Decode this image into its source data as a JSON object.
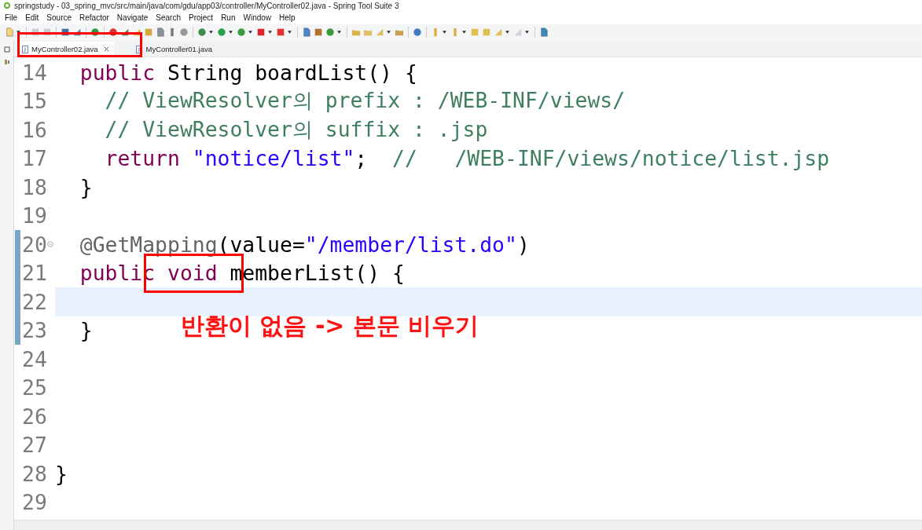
{
  "window": {
    "title": "springstudy - 03_spring_mvc/src/main/java/com/gdu/app03/controller/MyController02.java - Spring Tool Suite 3"
  },
  "menu": [
    "File",
    "Edit",
    "Source",
    "Refactor",
    "Navigate",
    "Search",
    "Project",
    "Run",
    "Window",
    "Help"
  ],
  "tabs": [
    {
      "label": "MyController02.java",
      "selected": true
    },
    {
      "label": "MyController01.java",
      "selected": false
    }
  ],
  "editor": {
    "lines": [
      {
        "number": "14",
        "current": false,
        "changed": false,
        "fold": false,
        "tokens": [
          {
            "kind": "keyword",
            "text": "  public"
          },
          {
            "kind": "plain",
            "text": " String boardList() {"
          }
        ]
      },
      {
        "number": "15",
        "current": false,
        "changed": false,
        "fold": false,
        "tokens": [
          {
            "kind": "comment",
            "text": "    // ViewResolver의 prefix : /WEB-INF/views/"
          }
        ]
      },
      {
        "number": "16",
        "current": false,
        "changed": false,
        "fold": false,
        "tokens": [
          {
            "kind": "comment",
            "text": "    // ViewResolver의 suffix : .jsp"
          }
        ]
      },
      {
        "number": "17",
        "current": false,
        "changed": false,
        "fold": false,
        "tokens": [
          {
            "kind": "keyword",
            "text": "    return "
          },
          {
            "kind": "string",
            "text": "\"notice/list\""
          },
          {
            "kind": "plain",
            "text": ";  "
          },
          {
            "kind": "comment",
            "text": "//   /WEB-INF/views/notice/list.jsp"
          }
        ]
      },
      {
        "number": "18",
        "current": false,
        "changed": false,
        "fold": false,
        "tokens": [
          {
            "kind": "plain",
            "text": "  }"
          }
        ]
      },
      {
        "number": "19",
        "current": false,
        "changed": false,
        "fold": false
      },
      {
        "number": "20",
        "current": false,
        "changed": true,
        "fold": true,
        "tokens": [
          {
            "kind": "annotation",
            "text": "  @GetMapping"
          },
          {
            "kind": "plain",
            "text": "(value="
          },
          {
            "kind": "string",
            "text": "\"/member/list.do\""
          },
          {
            "kind": "plain",
            "text": ")"
          }
        ]
      },
      {
        "number": "21",
        "current": false,
        "changed": true,
        "fold": false,
        "tokens": [
          {
            "kind": "keyword",
            "text": "  public "
          },
          {
            "kind": "keyword",
            "text": "void"
          },
          {
            "kind": "plain",
            "text": " memberList() {"
          }
        ]
      },
      {
        "number": "22",
        "current": true,
        "changed": true,
        "fold": false
      },
      {
        "number": "23",
        "current": false,
        "changed": true,
        "fold": false,
        "tokens": [
          {
            "kind": "plain",
            "text": "  }"
          }
        ]
      },
      {
        "number": "24",
        "current": false,
        "changed": false,
        "fold": false
      },
      {
        "number": "25",
        "current": false,
        "changed": false,
        "fold": false
      },
      {
        "number": "26",
        "current": false,
        "changed": false,
        "fold": false
      },
      {
        "number": "27",
        "current": false,
        "changed": false,
        "fold": false
      },
      {
        "number": "28",
        "current": false,
        "changed": false,
        "fold": false,
        "tokens": [
          {
            "kind": "plain",
            "text": "}"
          }
        ]
      },
      {
        "number": "29",
        "current": false,
        "changed": false,
        "fold": false
      }
    ]
  },
  "note": "반환이 없음 -> 본문 비우기"
}
